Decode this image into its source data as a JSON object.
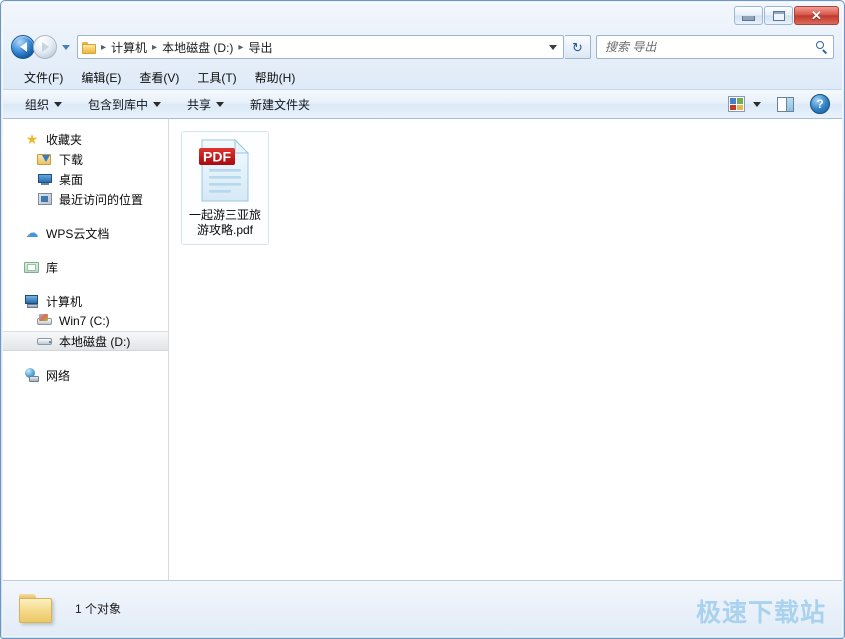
{
  "window": {
    "controls": {
      "minimize_label": "最小化",
      "maximize_label": "最大化",
      "close_label": "✕"
    }
  },
  "navigation": {
    "back_label": "后退",
    "forward_label": "前进",
    "history_label": "最近浏览的位置",
    "refresh_label": "↻",
    "breadcrumb": [
      "计算机",
      "本地磁盘 (D:)",
      "导出"
    ],
    "separator": "▸",
    "dropdown_label": "▾"
  },
  "search": {
    "placeholder": "搜索 导出",
    "value": ""
  },
  "menubar": {
    "items": [
      {
        "label": "文件(F)"
      },
      {
        "label": "编辑(E)"
      },
      {
        "label": "查看(V)"
      },
      {
        "label": "工具(T)"
      },
      {
        "label": "帮助(H)"
      }
    ]
  },
  "toolbar": {
    "items": [
      {
        "label": "组织",
        "has_caret": true
      },
      {
        "label": "包含到库中",
        "has_caret": true
      },
      {
        "label": "共享",
        "has_caret": true
      },
      {
        "label": "新建文件夹",
        "has_caret": false
      }
    ],
    "view_label": "更改您的视图",
    "view_caret": "▾",
    "preview_label": "显示预览窗格",
    "help_label": "?"
  },
  "sidebar": {
    "items": [
      {
        "label": "收藏夹",
        "icon": "star-icon",
        "level": 0,
        "selected": false,
        "gap_before": false
      },
      {
        "label": "下载",
        "icon": "download-folder-icon",
        "level": 1,
        "selected": false,
        "gap_before": false
      },
      {
        "label": "桌面",
        "icon": "desktop-icon",
        "level": 1,
        "selected": false,
        "gap_before": false
      },
      {
        "label": "最近访问的位置",
        "icon": "recent-places-icon",
        "level": 1,
        "selected": false,
        "gap_before": false
      },
      {
        "label": "WPS云文档",
        "icon": "cloud-icon",
        "level": 0,
        "selected": false,
        "gap_before": true
      },
      {
        "label": "库",
        "icon": "library-icon",
        "level": 0,
        "selected": false,
        "gap_before": true
      },
      {
        "label": "计算机",
        "icon": "computer-icon",
        "level": 0,
        "selected": false,
        "gap_before": true
      },
      {
        "label": "Win7 (C:)",
        "icon": "windows-drive-icon",
        "level": 1,
        "selected": false,
        "gap_before": false
      },
      {
        "label": "本地磁盘 (D:)",
        "icon": "drive-icon",
        "level": 1,
        "selected": true,
        "gap_before": false
      },
      {
        "label": "网络",
        "icon": "network-icon",
        "level": 0,
        "selected": false,
        "gap_before": true
      }
    ]
  },
  "content": {
    "files": [
      {
        "name": "一起游三亚旅游攻略.pdf",
        "icon": "pdf-file-icon",
        "badge": "PDF"
      }
    ]
  },
  "statusbar": {
    "icon": "folder-icon",
    "text": "1 个对象"
  },
  "watermark": {
    "text": "极速下载站"
  },
  "colors": {
    "accent_blue": "#2f80c4",
    "pdf_red": "#c3161c",
    "folder_yellow": "#f5dc90",
    "watermark_blue": "#a9d2ef",
    "close_red": "#c0392b"
  }
}
